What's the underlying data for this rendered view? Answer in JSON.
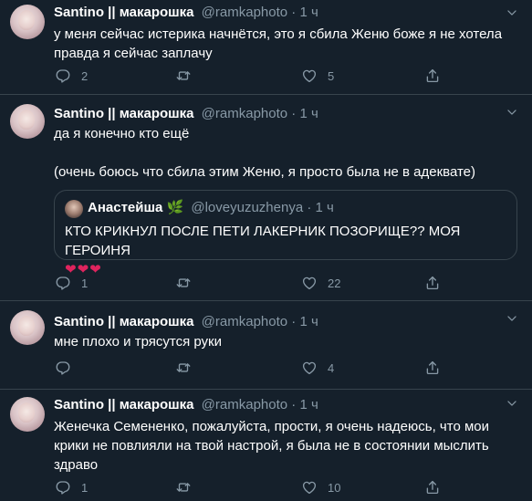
{
  "tweets": [
    {
      "name": "Santino || макарошка",
      "handle": "@ramkaphoto",
      "dot": "·",
      "time": "1 ч",
      "text_lines": [
        "у меня сейчас истерика начнётся, это я сбила Женю боже я не хотела",
        "правда я сейчас заплачу"
      ],
      "replies": "2",
      "retweets": "",
      "likes": "5"
    },
    {
      "name": "Santino || макарошка",
      "handle": "@ramkaphoto",
      "dot": "·",
      "time": "1 ч",
      "text_lines": [
        "да я конечно кто ещё",
        "(очень боюсь что сбила этим Женю, я просто была не в адеквате)"
      ],
      "quote": {
        "name": "Анастейша",
        "emoji": "🌿",
        "handle": "@loveyuzuzhenya",
        "dot": "·",
        "time": "1 ч",
        "text": "КТО КРИКНУЛ ПОСЛЕ ПЕТИ ЛАКЕРНИК ПОЗОРИЩЕ?? МОЯ ГЕРОИНЯ",
        "hearts": "❤❤❤"
      },
      "replies": "1",
      "retweets": "",
      "likes": "22"
    },
    {
      "name": "Santino || макарошка",
      "handle": "@ramkaphoto",
      "dot": "·",
      "time": "1 ч",
      "text_lines": [
        "мне плохо и трясутся руки"
      ],
      "replies": "",
      "retweets": "",
      "likes": "4"
    },
    {
      "name": "Santino || макарошка",
      "handle": "@ramkaphoto",
      "dot": "·",
      "time": "1 ч",
      "text_lines": [
        "Женечка Семененко, пожалуйста, прости, я очень надеюсь, что мои",
        "крики не повлияли на твой настрой, я была не в состоянии мыслить",
        "здраво"
      ],
      "replies": "1",
      "retweets": "",
      "likes": "10"
    }
  ],
  "colors": {
    "background": "#15202b",
    "border": "#38444d",
    "secondary_text": "#8899a6",
    "heart": "#e0245e"
  },
  "icons": [
    "chevron-down-icon",
    "reply-icon",
    "retweet-icon",
    "like-icon",
    "share-icon",
    "leaf-icon"
  ]
}
